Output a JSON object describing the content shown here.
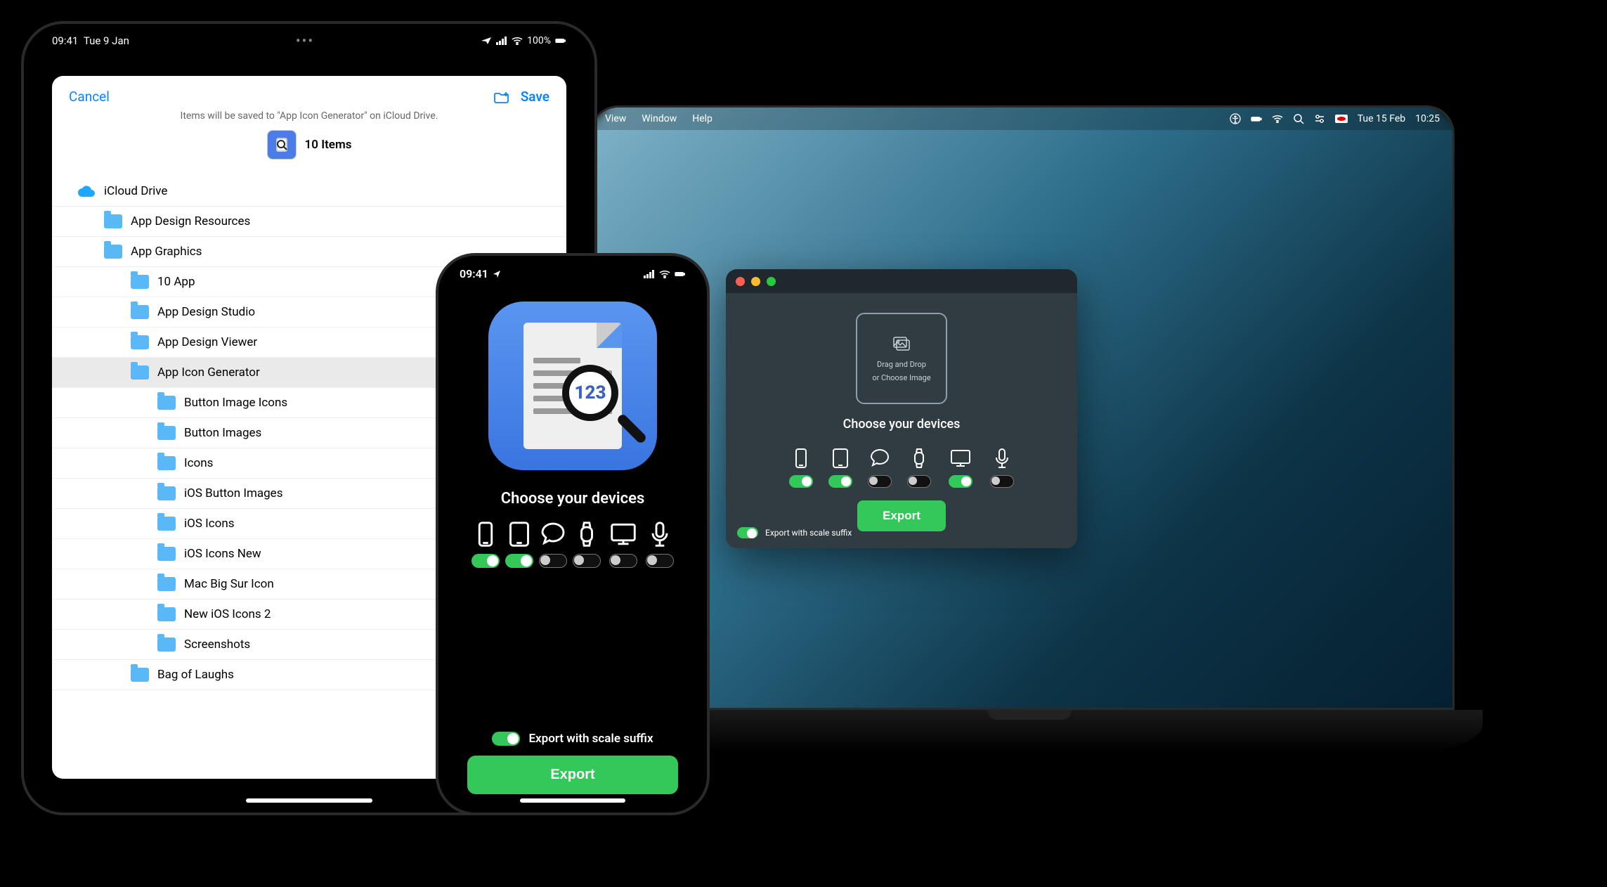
{
  "ipad": {
    "status": {
      "time": "09:41",
      "date": "Tue 9 Jan",
      "battery": "100%"
    },
    "sheet": {
      "cancel": "Cancel",
      "save": "Save",
      "subtitle": "Items will be saved to \"App Icon Generator\" on iCloud Drive.",
      "items_label": "10 Items",
      "tree": [
        {
          "depth": 0,
          "label": "iCloud Drive",
          "icon": "icloud"
        },
        {
          "depth": 1,
          "label": "App Design Resources",
          "icon": "folder"
        },
        {
          "depth": 1,
          "label": "App Graphics",
          "icon": "folder"
        },
        {
          "depth": 2,
          "label": "10 App",
          "icon": "folder"
        },
        {
          "depth": 2,
          "label": "App Design Studio",
          "icon": "folder"
        },
        {
          "depth": 2,
          "label": "App Design Viewer",
          "icon": "folder"
        },
        {
          "depth": 2,
          "label": "App Icon Generator",
          "icon": "folder",
          "selected": true
        },
        {
          "depth": 3,
          "label": "Button Image Icons",
          "icon": "folder"
        },
        {
          "depth": 3,
          "label": "Button Images",
          "icon": "folder"
        },
        {
          "depth": 3,
          "label": "Icons",
          "icon": "folder"
        },
        {
          "depth": 3,
          "label": "iOS Button Images",
          "icon": "folder"
        },
        {
          "depth": 3,
          "label": "iOS Icons",
          "icon": "folder"
        },
        {
          "depth": 3,
          "label": "iOS Icons New",
          "icon": "folder"
        },
        {
          "depth": 3,
          "label": "Mac Big Sur Icon",
          "icon": "folder"
        },
        {
          "depth": 3,
          "label": "New iOS Icons 2",
          "icon": "folder"
        },
        {
          "depth": 3,
          "label": "Screenshots",
          "icon": "folder"
        },
        {
          "depth": 2,
          "label": "Bag of Laughs",
          "icon": "folder"
        }
      ]
    }
  },
  "iphone": {
    "status": {
      "time": "09:41"
    },
    "icon_number": "123",
    "heading": "Choose your devices",
    "devices": [
      {
        "name": "iphone",
        "on": true
      },
      {
        "name": "ipad",
        "on": true
      },
      {
        "name": "messages",
        "on": false
      },
      {
        "name": "watch",
        "on": false
      },
      {
        "name": "mac",
        "on": false
      },
      {
        "name": "siri",
        "on": false
      }
    ],
    "suffix_label": "Export with scale suffix",
    "suffix_on": true,
    "export_label": "Export"
  },
  "mac": {
    "menubar": {
      "menus": [
        "View",
        "Window",
        "Help"
      ],
      "date": "Tue 15 Feb",
      "time": "10:25"
    },
    "window": {
      "dropzone_line1": "Drag and Drop",
      "dropzone_line2": "or Choose Image",
      "heading": "Choose your devices",
      "devices": [
        {
          "name": "iphone",
          "on": true
        },
        {
          "name": "ipad",
          "on": true
        },
        {
          "name": "messages",
          "on": false
        },
        {
          "name": "watch",
          "on": false
        },
        {
          "name": "mac",
          "on": true
        },
        {
          "name": "siri",
          "on": false
        }
      ],
      "export_label": "Export",
      "suffix_label": "Export with scale suffix",
      "suffix_on": true
    }
  }
}
